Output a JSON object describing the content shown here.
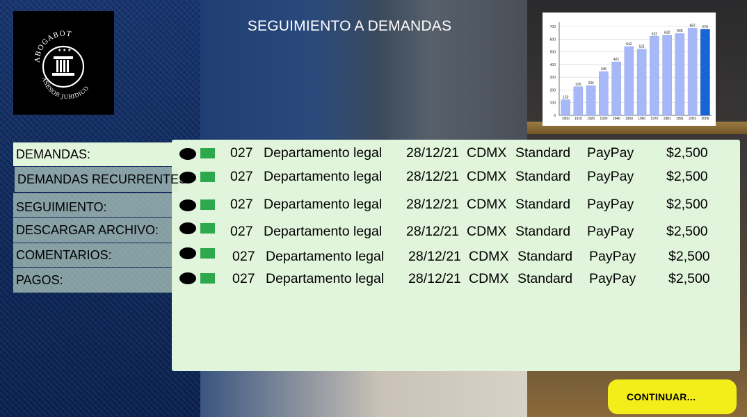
{
  "title": "SEGUIMIENTO A DEMANDAS",
  "logo": {
    "brand": "ABOGABOT",
    "tagline": "ASESOR JURIDICO",
    "icon": "pillar-icon"
  },
  "sidebar": {
    "items": [
      {
        "label": "DEMANDAS:"
      },
      {
        "label": "DEMANDAS RECURRENTES:"
      },
      {
        "label": "SEGUIMIENTO:"
      },
      {
        "label": "DESCARGAR ARCHIVO:"
      },
      {
        "label": "COMENTARIOS:"
      },
      {
        "label": "PAGOS:"
      }
    ]
  },
  "rows": [
    {
      "id": "027",
      "dept": "Departamento legal",
      "date": "28/12/21",
      "loc": "CDMX",
      "plan": "Standard",
      "method": "PayPay",
      "amount": "$2,500"
    },
    {
      "id": "027",
      "dept": "Departamento legal",
      "date": "28/12/21",
      "loc": "CDMX",
      "plan": "Standard",
      "method": "PayPay",
      "amount": "$2,500"
    },
    {
      "id": "027",
      "dept": "Departamento legal",
      "date": "28/12/21",
      "loc": "CDMX",
      "plan": "Standard",
      "method": "PayPay",
      "amount": "$2,500"
    },
    {
      "id": "027",
      "dept": "Departamento legal",
      "date": "28/12/21",
      "loc": "CDMX",
      "plan": "Standard",
      "method": "PayPay",
      "amount": "$2,500"
    },
    {
      "id": "027",
      "dept": "Departamento legal",
      "date": "28/12/21",
      "loc": "CDMX",
      "plan": "Standard",
      "method": "PayPay",
      "amount": "$2,500"
    },
    {
      "id": "027",
      "dept": "Departamento legal",
      "date": "28/12/21",
      "loc": "CDMX",
      "plan": "Standard",
      "method": "PayPay",
      "amount": "$2,500"
    }
  ],
  "continue_label": "CONTINUAR...",
  "colors": {
    "panel": "#e1f5dc",
    "status_square": "#2ea84c",
    "button": "#f3ee1a",
    "bar": "#a6b8f7",
    "bar_highlight": "#1565d8"
  },
  "chart_data": {
    "type": "bar",
    "categories": [
      "1900",
      "1910",
      "1920",
      "1930",
      "1940",
      "1950",
      "1960",
      "1970",
      "1981",
      "1991",
      "2001",
      "2006"
    ],
    "values": [
      123,
      225,
      234,
      345,
      421,
      542,
      521,
      622,
      632,
      645,
      687,
      676
    ],
    "ylim": [
      0,
      700
    ],
    "yticks": [
      "0",
      "100",
      "200",
      "300",
      "400",
      "500",
      "600",
      "700"
    ],
    "grid": true
  }
}
